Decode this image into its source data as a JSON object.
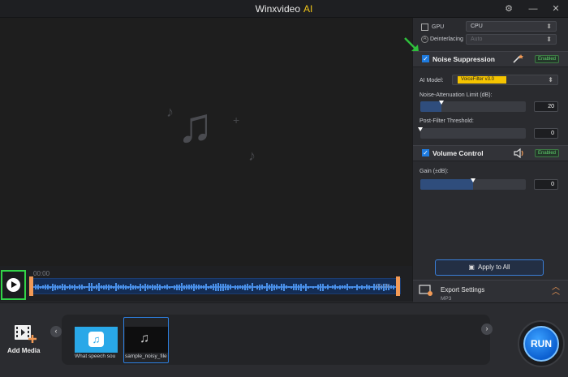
{
  "titlebar": {
    "app_name": "Winxvideo",
    "app_suffix": "AI",
    "gear_icon": "gear-icon",
    "minimize_icon": "minimize-icon",
    "close_icon": "close-icon"
  },
  "preview": {
    "time_start": "00:00",
    "time_end": "00:08"
  },
  "panel": {
    "gpu_label": "GPU",
    "gpu_value": "CPU",
    "deinterlacing_label": "Deinterlacing",
    "deinterlacing_value": "Auto",
    "noise": {
      "title": "Noise Suppression",
      "badge": "Enabled",
      "ai_model_label": "AI Model:",
      "ai_model_value": "VoiceFilter v3.0",
      "limit_label": "Noise-Attenuation Limit (dB):",
      "limit_value": "20",
      "limit_fraction": 0.2,
      "threshold_label": "Post-Filter Threshold:",
      "threshold_value": "0",
      "threshold_fraction": 0
    },
    "volume": {
      "title": "Volume Control",
      "badge": "Enabled",
      "gain_label": "Gain (±dB):",
      "gain_value": "0",
      "gain_fraction": 0.5
    },
    "apply_label": "Apply to All",
    "export_title": "Export Settings",
    "export_format": "MP3"
  },
  "bottom": {
    "add_media_label": "Add Media",
    "items": [
      {
        "name": "What speech sou"
      },
      {
        "name": "sample_noisy_file"
      }
    ],
    "run_label": "RUN"
  },
  "colors": {
    "accent": "#1e7be0",
    "green_highlight": "#32d448",
    "handle": "#f29a56",
    "ai_model_bg": "#f5c400"
  }
}
